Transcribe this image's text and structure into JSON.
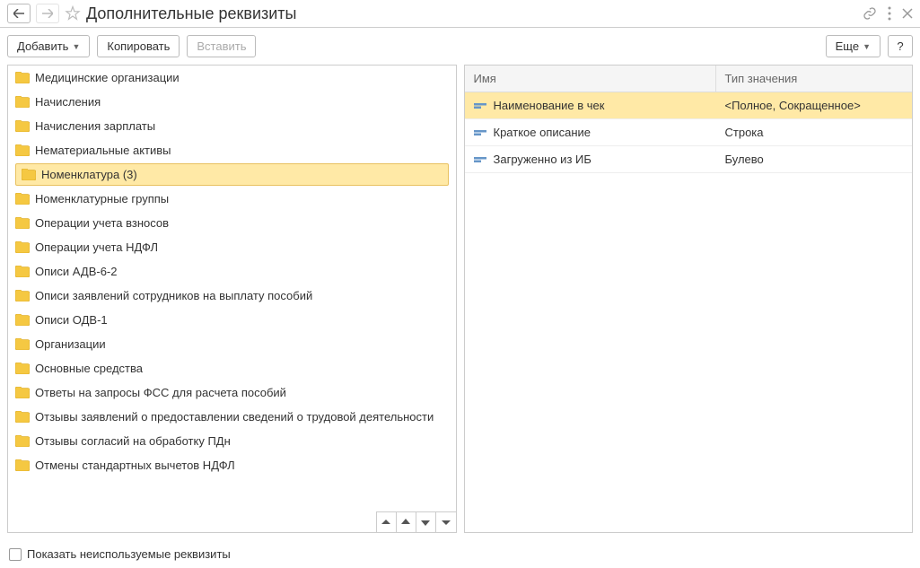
{
  "title": "Дополнительные реквизиты",
  "toolbar": {
    "add": "Добавить",
    "copy": "Копировать",
    "paste": "Вставить",
    "more": "Еще",
    "help": "?"
  },
  "tree": {
    "items": [
      {
        "label": "Медицинские организации",
        "selected": false
      },
      {
        "label": "Начисления",
        "selected": false
      },
      {
        "label": "Начисления зарплаты",
        "selected": false
      },
      {
        "label": "Нематериальные активы",
        "selected": false
      },
      {
        "label": "Номенклатура (3)",
        "selected": true
      },
      {
        "label": "Номенклатурные группы",
        "selected": false
      },
      {
        "label": "Операции учета взносов",
        "selected": false
      },
      {
        "label": "Операции учета НДФЛ",
        "selected": false
      },
      {
        "label": "Описи АДВ-6-2",
        "selected": false
      },
      {
        "label": "Описи заявлений сотрудников на выплату пособий",
        "selected": false
      },
      {
        "label": "Описи ОДВ-1",
        "selected": false
      },
      {
        "label": "Организации",
        "selected": false
      },
      {
        "label": "Основные средства",
        "selected": false
      },
      {
        "label": "Ответы на запросы ФСС для расчета пособий",
        "selected": false
      },
      {
        "label": "Отзывы заявлений о предоставлении сведений о трудовой деятельности",
        "selected": false
      },
      {
        "label": "Отзывы согласий на обработку ПДн",
        "selected": false
      },
      {
        "label": "Отмены стандартных вычетов НДФЛ",
        "selected": false
      }
    ]
  },
  "table": {
    "headers": {
      "name": "Имя",
      "type": "Тип значения"
    },
    "rows": [
      {
        "name": "Наименование в чек",
        "type": "<Полное, Сокращенное>",
        "selected": true
      },
      {
        "name": "Краткое описание",
        "type": "Строка",
        "selected": false
      },
      {
        "name": "Загруженно из ИБ",
        "type": "Булево",
        "selected": false
      }
    ]
  },
  "footer": {
    "label": "Показать неиспользуемые реквизиты"
  }
}
